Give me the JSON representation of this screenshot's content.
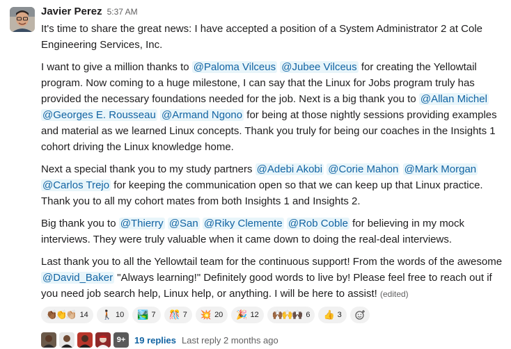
{
  "message": {
    "author": "Javier Perez",
    "timestamp": "5:37 AM",
    "paragraphs": [
      [
        {
          "t": "It's time to share the great news: I have accepted a position of a System Administrator 2 at Cole Engineering Services, Inc."
        }
      ],
      [
        {
          "t": "I want to give a million thanks to "
        },
        {
          "m": "@Paloma Vilceus"
        },
        {
          "t": " "
        },
        {
          "m": "@Jubee Vilceus"
        },
        {
          "t": " for creating the Yellowtail program.  Now coming to a huge milestone, I can say that the Linux for Jobs program truly has provided the necessary foundations needed for the job. Next is a big thank you to "
        },
        {
          "m": "@Allan Michel"
        },
        {
          "t": " "
        },
        {
          "m": "@Georges E. Rousseau"
        },
        {
          "t": " "
        },
        {
          "m": "@Armand Ngono"
        },
        {
          "t": " for being at those nightly sessions providing examples and material as we learned Linux concepts. Thank you truly for being our coaches in the Insights 1 cohort driving the Linux knowledge home."
        }
      ],
      [
        {
          "t": "Next a special thank you to my study partners "
        },
        {
          "m": "@Adebi Akobi"
        },
        {
          "t": " "
        },
        {
          "m": "@Corie Mahon"
        },
        {
          "t": " "
        },
        {
          "m": "@Mark Morgan"
        },
        {
          "t": " "
        },
        {
          "m": "@Carlos Trejo"
        },
        {
          "t": " for keeping the communication open so that we can keep up that Linux practice. Thank you to all my cohort mates from both Insights 1 and Insights 2."
        }
      ],
      [
        {
          "t": "Big thank you to "
        },
        {
          "m": "@Thierry"
        },
        {
          "t": " "
        },
        {
          "m": "@San"
        },
        {
          "t": " "
        },
        {
          "m": "@Riky Clemente"
        },
        {
          "t": " "
        },
        {
          "m": "@Rob Coble"
        },
        {
          "t": " for believing in my mock interviews. They were truly valuable when it came down to doing the real-deal interviews."
        }
      ],
      [
        {
          "t": "Last thank you to all the Yellowtail team for the continuous support! From the words of the awesome "
        },
        {
          "m": "@David_Baker"
        },
        {
          "t": " \"Always learning!\" Definitely good words to live by! Please feel free to reach out if you need job search help, Linux help, or anything. I will be here to assist! "
        },
        {
          "e": "(edited)"
        }
      ]
    ]
  },
  "reactions": [
    {
      "icon": "clap-hands-icon",
      "emoji": "👏🏾👏👏🏼",
      "count": "14"
    },
    {
      "icon": "walking-person-icon",
      "emoji": "🚶🏿",
      "count": "10"
    },
    {
      "icon": "graduation-image-icon",
      "emoji": "🏞️",
      "count": "7"
    },
    {
      "icon": "congrats-icon",
      "emoji": "🎊",
      "count": "7"
    },
    {
      "icon": "collision-icon",
      "emoji": "💥",
      "count": "20"
    },
    {
      "icon": "party-popper-icon",
      "emoji": "🎉",
      "count": "12"
    },
    {
      "icon": "raised-hands-icon",
      "emoji": "🙌🏾🙌🙌🏿",
      "count": "6"
    },
    {
      "icon": "thumbs-up-icon",
      "emoji": "👍",
      "count": "3"
    }
  ],
  "thread": {
    "more_count": "9+",
    "replies": "19 replies",
    "last_reply": "Last reply 2 months ago"
  },
  "colors": {
    "mention_text": "#1264a3",
    "mention_bg": "#e8f5fa",
    "link": "#1264a3",
    "muted": "#616061"
  }
}
